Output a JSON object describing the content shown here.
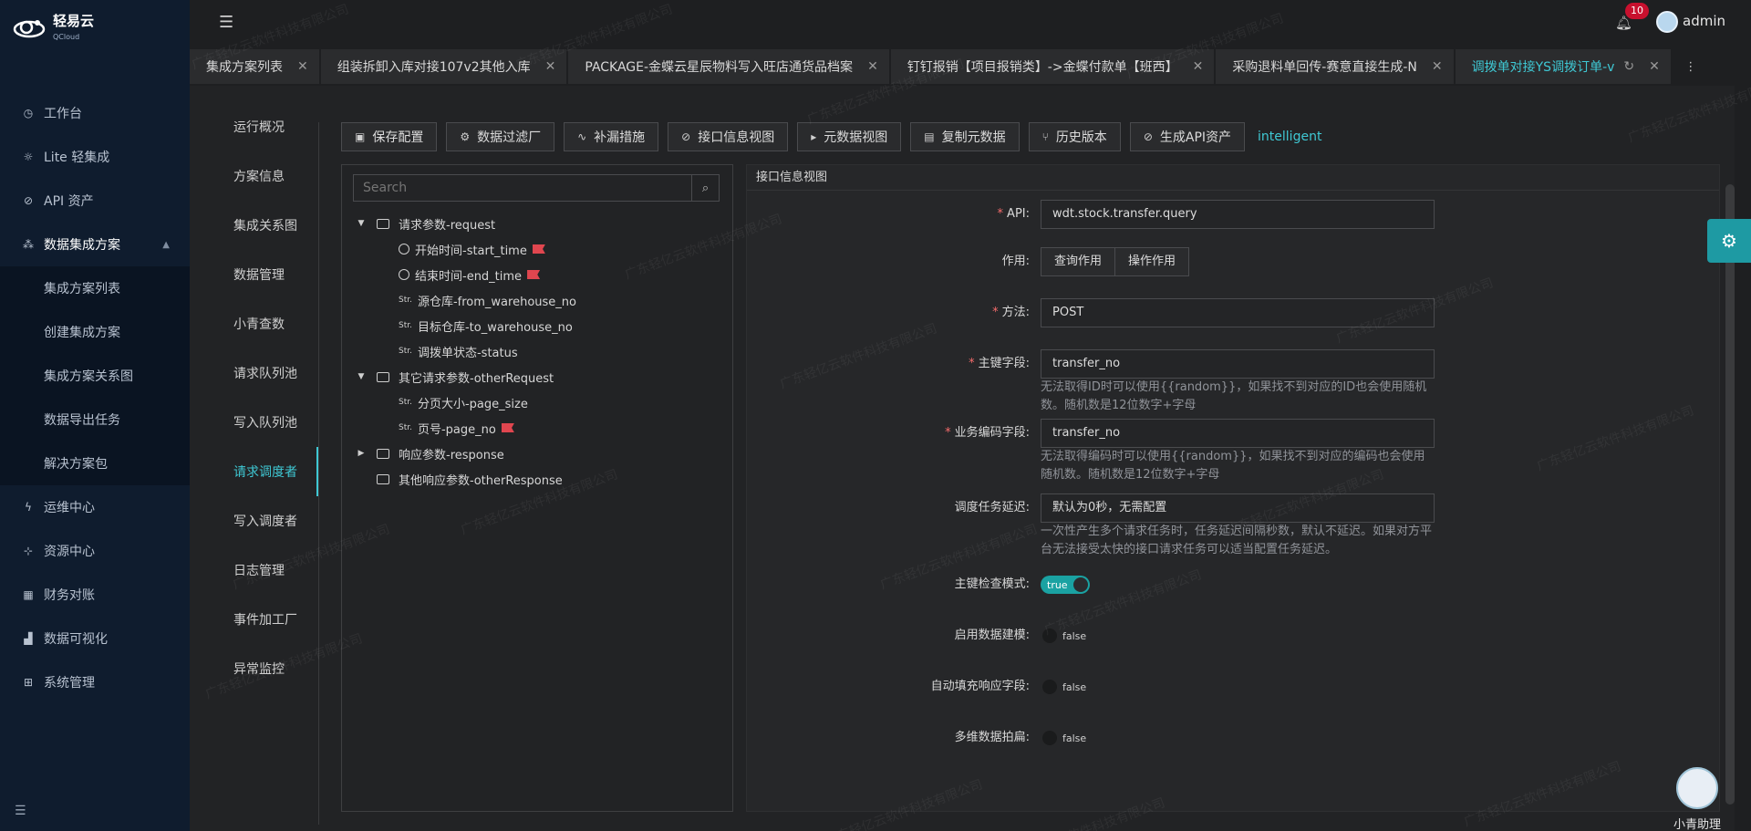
{
  "brand": {
    "name": "轻易云",
    "sub": "QCloud"
  },
  "sidebar": {
    "items": [
      {
        "label": "工作台",
        "icon": "clock-icon"
      },
      {
        "label": "Lite 轻集成",
        "icon": "bulb-icon"
      },
      {
        "label": "API 资产",
        "icon": "compass-icon"
      },
      {
        "label": "数据集成方案",
        "icon": "network-icon",
        "open": true
      }
    ],
    "sub_items": [
      "集成方案列表",
      "创建集成方案",
      "集成方案关系图",
      "数据导出任务",
      "解决方案包"
    ],
    "items_after": [
      {
        "label": "运维中心",
        "icon": "bolt-icon"
      },
      {
        "label": "资源中心",
        "icon": "hierarchy-icon"
      },
      {
        "label": "财务对账",
        "icon": "ledger-icon"
      },
      {
        "label": "数据可视化",
        "icon": "chart-icon"
      },
      {
        "label": "系统管理",
        "icon": "grid-icon"
      }
    ]
  },
  "header": {
    "badge": "10",
    "user": "admin"
  },
  "tabs": [
    {
      "label": "集成方案列表"
    },
    {
      "label": "组装拆卸入库对接107v2其他入库"
    },
    {
      "label": "PACKAGE-金蝶云星辰物料写入旺店通货品档案"
    },
    {
      "label": "钉钉报销【项目报销类】->金蝶付款单【班西】"
    },
    {
      "label": "采购退料单回传-赛意直接生成-N"
    },
    {
      "label": "调拨单对接YS调拨订单-v",
      "active": true
    }
  ],
  "subnav": [
    "运行概况",
    "方案信息",
    "集成关系图",
    "数据管理",
    "小青查数",
    "请求队列池",
    "写入队列池",
    "请求调度者",
    "写入调度者",
    "日志管理",
    "事件加工厂",
    "异常监控"
  ],
  "subnav_active": 7,
  "toolbar": {
    "buttons": [
      {
        "label": "保存配置",
        "icon": "save-icon",
        "glyph": "▣"
      },
      {
        "label": "数据过滤厂",
        "icon": "gear-icon",
        "glyph": "⚙"
      },
      {
        "label": "补漏措施",
        "icon": "trend-icon",
        "glyph": "∿"
      },
      {
        "label": "接口信息视图",
        "icon": "link-icon",
        "glyph": "⊘"
      },
      {
        "label": "元数据视图",
        "icon": "terminal-icon",
        "glyph": "▸"
      },
      {
        "label": "复制元数据",
        "icon": "copy-icon",
        "glyph": "▤"
      },
      {
        "label": "历史版本",
        "icon": "branch-icon",
        "glyph": "⑂"
      },
      {
        "label": "生成API资产",
        "icon": "link-icon",
        "glyph": "⊘"
      }
    ],
    "extra": "intelligent"
  },
  "tree": {
    "search_placeholder": "Search",
    "nodes": [
      {
        "label": "请求参数-request",
        "level": 0,
        "kind": "folder",
        "caret": "▼"
      },
      {
        "label": "开始时间-start_time",
        "level": 1,
        "kind": "clock",
        "flag": true
      },
      {
        "label": "结束时间-end_time",
        "level": 1,
        "kind": "clock",
        "flag": true
      },
      {
        "label": "源仓库-from_warehouse_no",
        "level": 1,
        "kind": "str"
      },
      {
        "label": "目标仓库-to_warehouse_no",
        "level": 1,
        "kind": "str"
      },
      {
        "label": "调拨单状态-status",
        "level": 1,
        "kind": "str"
      },
      {
        "label": "其它请求参数-otherRequest",
        "level": 0,
        "kind": "folder",
        "caret": "▼"
      },
      {
        "label": "分页大小-page_size",
        "level": 1,
        "kind": "str"
      },
      {
        "label": "页号-page_no",
        "level": 1,
        "kind": "str",
        "flag": true
      },
      {
        "label": "响应参数-response",
        "level": 0,
        "kind": "folder",
        "caret": "▶"
      },
      {
        "label": "其他响应参数-otherResponse",
        "level": 0,
        "kind": "folder",
        "caret": ""
      }
    ],
    "str_tag": "Str."
  },
  "form": {
    "title": "接口信息视图",
    "api_label": "API:",
    "api_value": "wdt.stock.transfer.query",
    "role_label": "作用:",
    "role_query": "查询作用",
    "role_op": "操作作用",
    "method_label": "方法:",
    "method_value": "POST",
    "pk_label": "主键字段:",
    "pk_value": "transfer_no",
    "pk_hint": "无法取得ID时可以使用{{random}}，如果找不到对应的ID也会使用随机数。随机数是12位数字+字母",
    "biz_label": "业务编码字段:",
    "biz_value": "transfer_no",
    "biz_hint": "无法取得编码时可以使用{{random}}，如果找不到对应的编码也会使用随机数。随机数是12位数字+字母",
    "delay_label": "调度任务延迟:",
    "delay_value": "默认为0秒，无需配置",
    "delay_hint": "一次性产生多个请求任务时，任务延迟间隔秒数，默认不延迟。如果对方平台无法接受太快的接口请求任务可以适当配置任务延迟。",
    "pkcheck_label": "主键检查模式:",
    "pkcheck_value": "true",
    "model_label": "启用数据建模:",
    "model_value": "false",
    "autofill_label": "自动填充响应字段:",
    "autofill_value": "false",
    "flatten_label": "多维数据拍扁:",
    "flatten_value": "false"
  },
  "assistant": {
    "label": "小青助理"
  },
  "watermark": "广东轻亿云软件科技有限公司",
  "colors": {
    "accent": "#3fc8d4",
    "sidebar": "#0f1c2e",
    "badge": "#c8102e"
  }
}
